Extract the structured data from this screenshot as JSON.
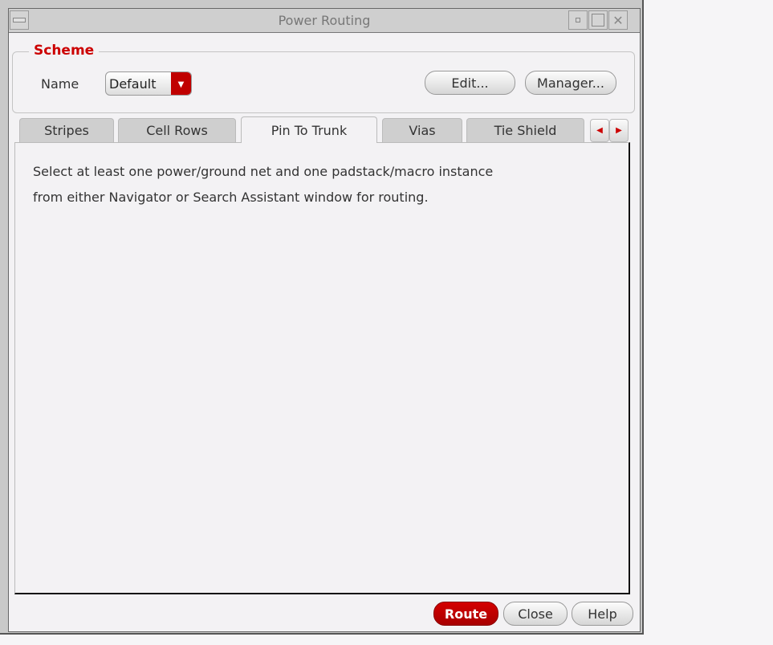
{
  "window": {
    "title": "Power Routing"
  },
  "scheme": {
    "legend": "Scheme",
    "name_label": "Name",
    "name_value": "Default",
    "edit_label": "Edit...",
    "manager_label": "Manager..."
  },
  "tabs": [
    {
      "label": "Stripes"
    },
    {
      "label": "Cell Rows"
    },
    {
      "label": "Pin To Trunk"
    },
    {
      "label": "Vias"
    },
    {
      "label": "Tie Shield"
    }
  ],
  "active_tab": "Pin To Trunk",
  "panel": {
    "line1": "Select at least one power/ground net and one padstack/macro instance",
    "line2": "from either Navigator or Search Assistant window for routing."
  },
  "footer": {
    "route_label": "Route",
    "close_label": "Close",
    "help_label": "Help"
  },
  "colors": {
    "accent": "#cc0000"
  }
}
